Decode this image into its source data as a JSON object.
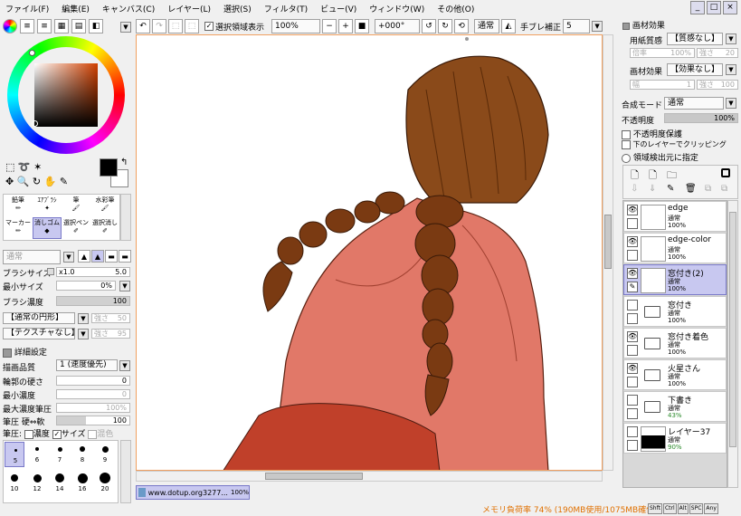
{
  "menu": [
    "ファイル(F)",
    "編集(E)",
    "キャンバス(C)",
    "レイヤー(L)",
    "選択(S)",
    "フィルタ(T)",
    "ビュー(V)",
    "ウィンドウ(W)",
    "その他(O)"
  ],
  "window_buttons": [
    "_",
    "□",
    "×"
  ],
  "toolbar": {
    "selection_show": "選択領域表示",
    "zoom": "100%",
    "angle": "+000°",
    "blend": "通常",
    "stabilizer_label": "手ブレ補正",
    "stabilizer_value": "5"
  },
  "tools": {
    "row1": [
      "鉛筆",
      "ｴｱﾌﾞﾗｼ",
      "筆",
      "水彩筆"
    ],
    "row2": [
      "マーカー",
      "消しゴム",
      "選択ペン",
      "選択消し"
    ],
    "selected": "消しゴム"
  },
  "brush": {
    "mode": "通常",
    "size_label": "ブラシサイズ",
    "size_mult": "x1.0",
    "size_value": "5.0",
    "min_size_label": "最小サイズ",
    "min_size_value": "0%",
    "density_label": "ブラシ濃度",
    "density_value": "100",
    "density_fraction": 1.0,
    "shape": "【通常の円形】",
    "shape_strength_label": "強さ",
    "shape_strength": "50",
    "texture": "【テクスチャなし】",
    "texture_strength_label": "強さ",
    "texture_strength": "95",
    "detail_label": "詳細設定",
    "quality_label": "描画品質",
    "quality_value": "1 (速度優先)",
    "edge_label": "輪郭の硬さ",
    "edge_value": "0",
    "min_density_label": "最小濃度",
    "min_density_value": "0",
    "max_pressure_label": "最大濃度筆圧",
    "max_pressure_value": "100%",
    "pressure_label": "筆圧 硬⇔軟",
    "pressure_value": "100",
    "pressure_opts_label": "筆圧:",
    "pressure_density": "濃度",
    "pressure_size": "サイズ",
    "pressure_blend": "混色"
  },
  "brush_sizes": [
    "5",
    "6",
    "7",
    "8",
    "9",
    "10",
    "12",
    "14",
    "16",
    "20"
  ],
  "canvas_tab": {
    "label": "www.dotup.org3277...",
    "zoom": "100%"
  },
  "paper": {
    "title": "画材効果",
    "texture_label": "用紙質感",
    "texture_value": "【質感なし】",
    "scale_label": "倍率",
    "scale_value": "100%",
    "str1_label": "強さ",
    "str1_value": "20",
    "effect_label": "画材効果",
    "effect_value": "【効果なし】",
    "width_label": "幅",
    "width_value": "1",
    "str2_label": "強さ",
    "str2_value": "100"
  },
  "layer_props": {
    "mode_label": "合成モード",
    "mode_value": "通常",
    "opacity_label": "不透明度",
    "opacity_value": "100%",
    "protect": "不透明度保護",
    "clip": "下のレイヤーでクリッピング",
    "source": "領域検出元に指定"
  },
  "layers": [
    {
      "name": "edge",
      "mode": "通常",
      "opacity": "100%",
      "visible": true,
      "folder": false,
      "selected": false
    },
    {
      "name": "edge-color",
      "mode": "通常",
      "opacity": "100%",
      "visible": true,
      "folder": false,
      "selected": false
    },
    {
      "name": "窓付き(2)",
      "mode": "通常",
      "opacity": "100%",
      "visible": true,
      "folder": false,
      "selected": true
    },
    {
      "name": "窓付き",
      "mode": "通常",
      "opacity": "100%",
      "visible": false,
      "folder": true,
      "selected": false
    },
    {
      "name": "窓付き着色",
      "mode": "通常",
      "opacity": "100%",
      "visible": true,
      "folder": true,
      "selected": false
    },
    {
      "name": "火星さん",
      "mode": "通常",
      "opacity": "100%",
      "visible": true,
      "folder": true,
      "selected": false
    },
    {
      "name": "下書き",
      "mode": "通常",
      "opacity": "43%",
      "visible": false,
      "folder": true,
      "selected": false
    },
    {
      "name": "レイヤー37",
      "mode": "通常",
      "opacity": "90%",
      "visible": false,
      "folder": false,
      "selected": false
    }
  ],
  "status": {
    "memory": "メモリ負荷率 74% (190MB使用/1075MB確保)",
    "keys": [
      "Shft",
      "Ctrl",
      "Alt",
      "SPC",
      "Any"
    ]
  },
  "colors": {
    "accent": "#7878c8",
    "status_text": "#e07000",
    "hair": "#7a3a12",
    "shirt": "#e07060"
  }
}
